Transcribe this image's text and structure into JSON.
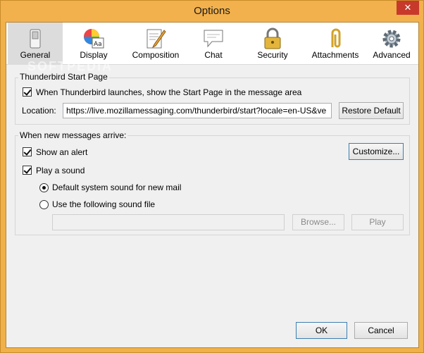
{
  "window": {
    "title": "Options",
    "close_glyph": "✕"
  },
  "toolbar": {
    "items": [
      {
        "label": "General",
        "icon": "general-switch-icon",
        "selected": true
      },
      {
        "label": "Display",
        "icon": "display-palette-icon",
        "selected": false
      },
      {
        "label": "Composition",
        "icon": "composition-pencil-icon",
        "selected": false
      },
      {
        "label": "Chat",
        "icon": "chat-bubble-icon",
        "selected": false
      },
      {
        "label": "Security",
        "icon": "security-lock-icon",
        "selected": false
      },
      {
        "label": "Attachments",
        "icon": "paperclip-icon",
        "selected": false
      },
      {
        "label": "Advanced",
        "icon": "gear-icon",
        "selected": false
      }
    ]
  },
  "start_page": {
    "group_title": "Thunderbird Start Page",
    "show_start_page_label": "When Thunderbird launches, show the Start Page in the message area",
    "show_start_page_checked": true,
    "location_label": "Location:",
    "location_value": "https://live.mozillamessaging.com/thunderbird/start?locale=en-US&ve",
    "restore_default_label": "Restore Default"
  },
  "new_messages": {
    "group_title": "When new messages arrive:",
    "show_alert_label": "Show an alert",
    "show_alert_checked": true,
    "customize_label": "Customize...",
    "play_sound_label": "Play a sound",
    "play_sound_checked": true,
    "default_sound_label": "Default system sound for new mail",
    "default_sound_selected": true,
    "use_sound_file_label": "Use the following sound file",
    "use_sound_file_selected": false,
    "sound_file_value": "",
    "browse_label": "Browse...",
    "play_label": "Play"
  },
  "footer": {
    "ok_label": "OK",
    "cancel_label": "Cancel"
  },
  "watermark": "SOFTPEDIA",
  "colors": {
    "title_bar": "#f2b14c",
    "close_button": "#c7392b",
    "selected_tab": "#dcdcdc",
    "dialog_bg": "#f0f0f0"
  }
}
